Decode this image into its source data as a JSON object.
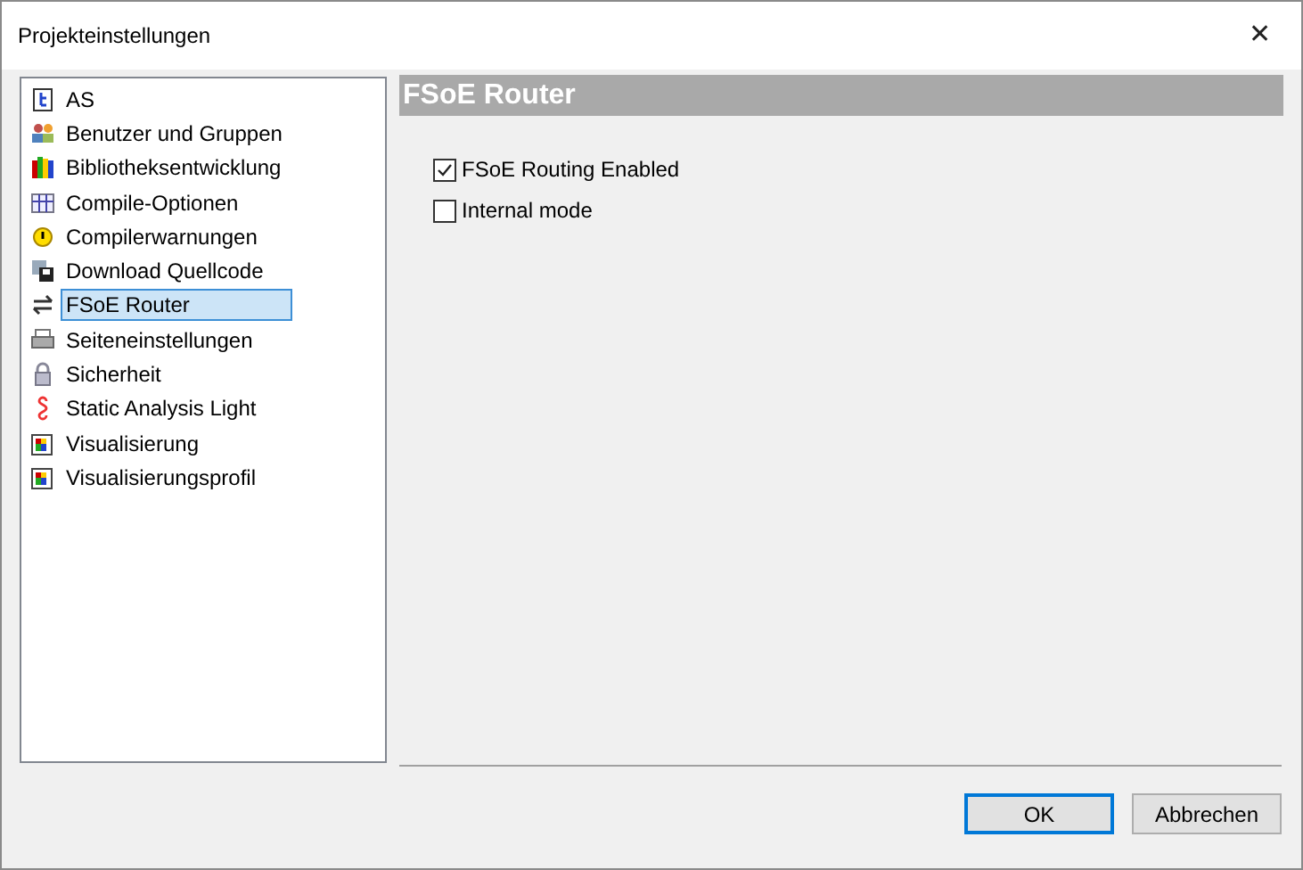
{
  "window": {
    "title": "Projekteinstellungen",
    "close": "✕"
  },
  "sidebar": {
    "items": [
      {
        "label": "AS",
        "kind": "as",
        "selected": false
      },
      {
        "label": "Benutzer und Gruppen",
        "kind": "users",
        "selected": false
      },
      {
        "label": "Bibliotheksentwicklung",
        "kind": "books",
        "selected": false
      },
      {
        "label": "Compile-Optionen",
        "kind": "compile",
        "selected": false
      },
      {
        "label": "Compilerwarnungen",
        "kind": "warning",
        "selected": false
      },
      {
        "label": "Download Quellcode",
        "kind": "download",
        "selected": false
      },
      {
        "label": "FSoE Router",
        "kind": "router",
        "selected": true
      },
      {
        "label": "Seiteneinstellungen",
        "kind": "printer",
        "selected": false
      },
      {
        "label": "Sicherheit",
        "kind": "lock",
        "selected": false
      },
      {
        "label": "Static Analysis Light",
        "kind": "paragraph",
        "selected": false
      },
      {
        "label": "Visualisierung",
        "kind": "visual",
        "selected": false
      },
      {
        "label": "Visualisierungsprofil",
        "kind": "visual",
        "selected": false
      }
    ]
  },
  "panel": {
    "title": "FSoE Router",
    "options": [
      {
        "label": "FSoE Routing Enabled",
        "checked": true
      },
      {
        "label": "Internal mode",
        "checked": false
      }
    ]
  },
  "buttons": [
    {
      "label": "OK",
      "default": true
    },
    {
      "label": "Abbrechen",
      "default": false
    }
  ]
}
